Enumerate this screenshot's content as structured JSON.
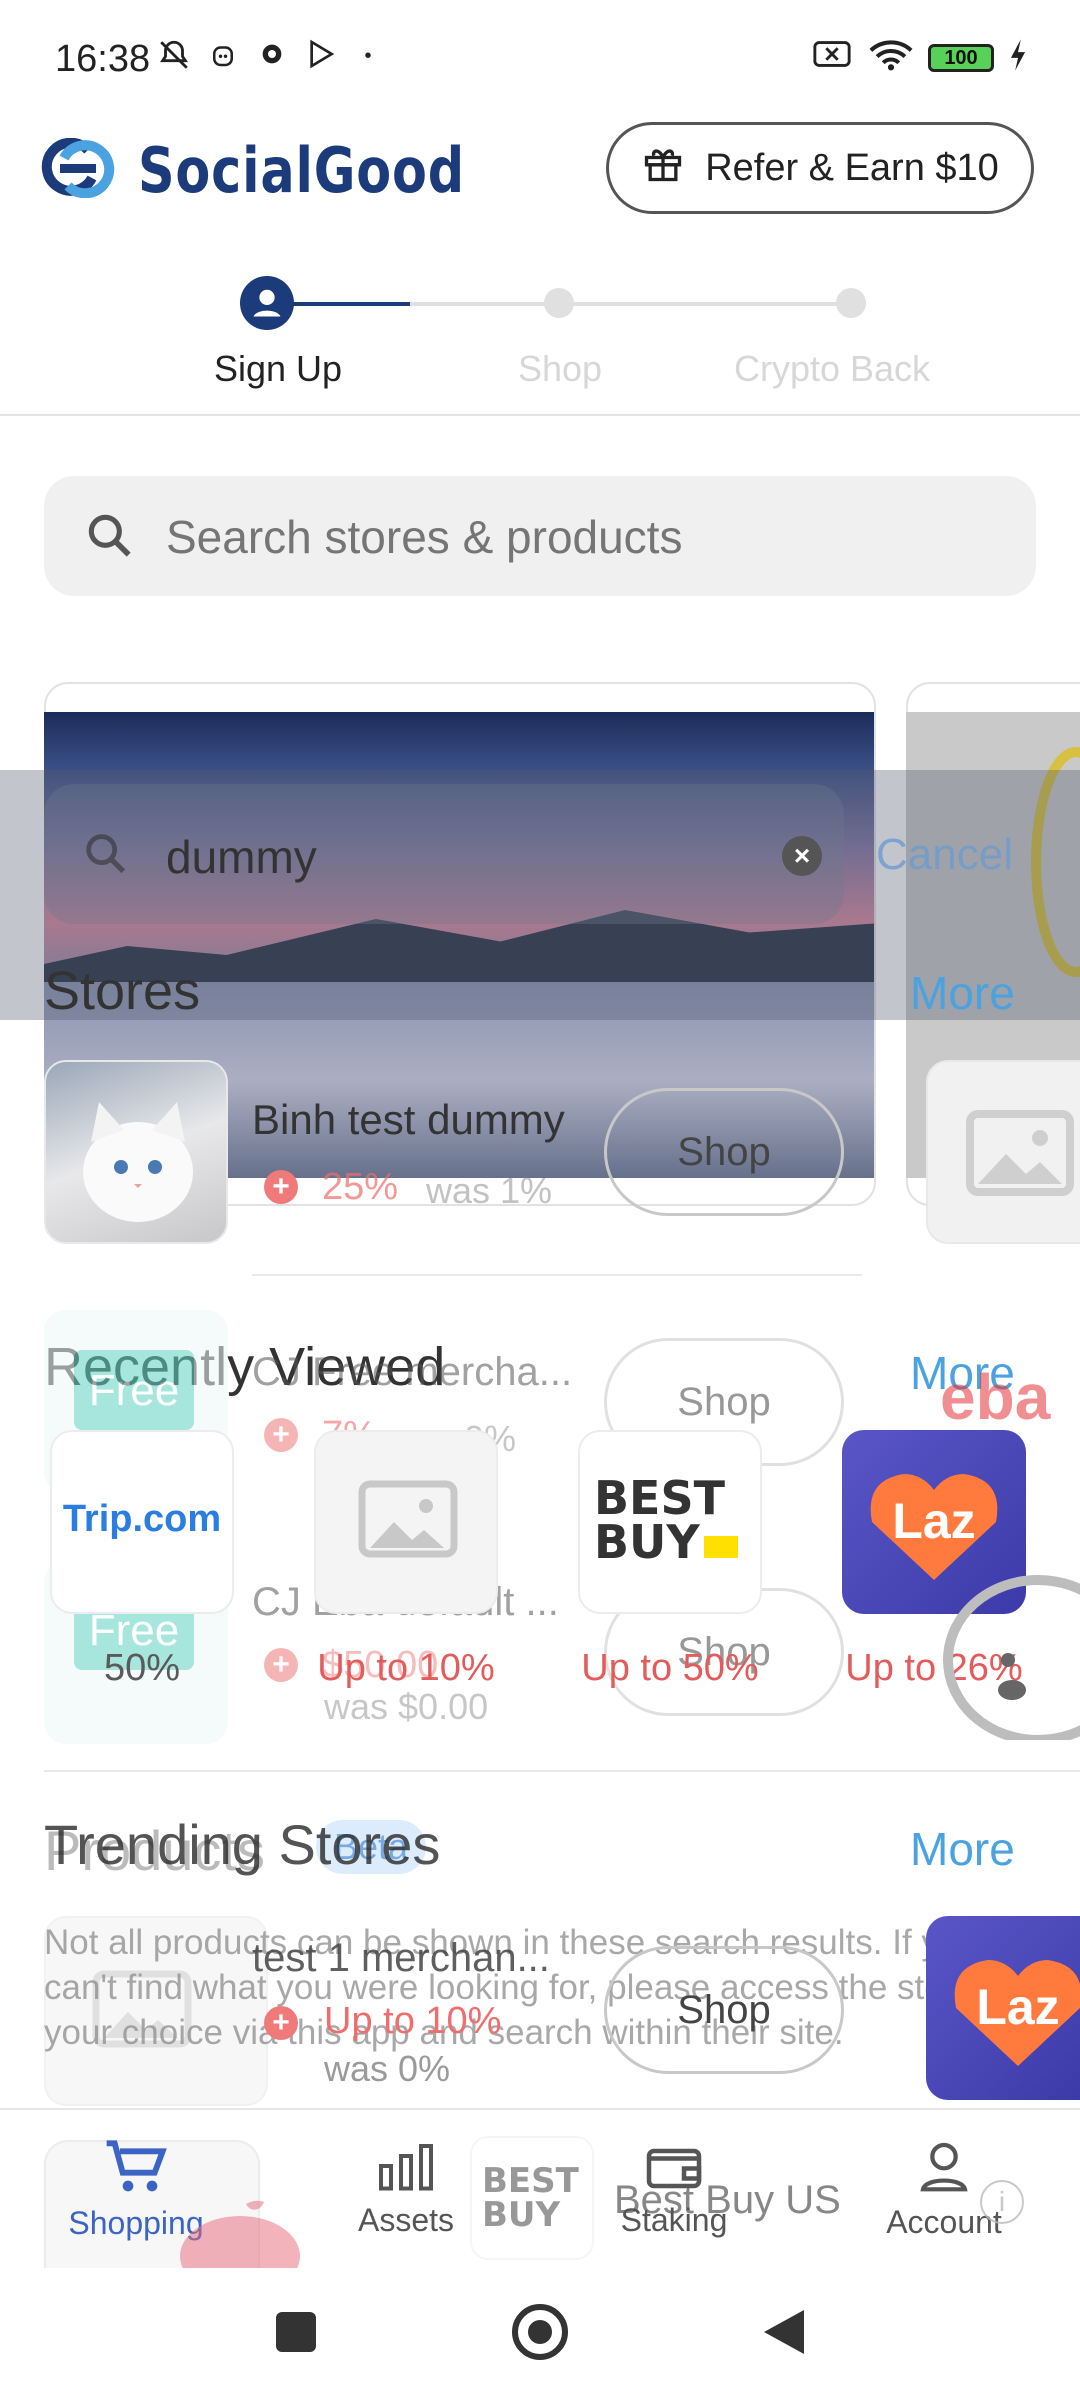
{
  "status_bar": {
    "time": "16:38",
    "battery": "100"
  },
  "header": {
    "brand": "SocialGood",
    "refer_label": "Refer & Earn $10"
  },
  "steps": [
    {
      "label": "Sign Up",
      "active": true
    },
    {
      "label": "Shop",
      "active": false
    },
    {
      "label": "Crypto Back",
      "active": false
    }
  ],
  "search": {
    "placeholder": "Search stores & products"
  },
  "overlay_search": {
    "query": "dummy",
    "cancel_label": "Cancel"
  },
  "stores_section": {
    "title": "Stores",
    "more_label": "More",
    "items": [
      {
        "name": "Binh test dummy",
        "cashback": "25%",
        "was": "was 1%",
        "action": "Shop"
      },
      {
        "name": "CJ Free merchant",
        "name_display": "CJ Free mercha...",
        "cashback": "7%",
        "was": "was 0%",
        "action": "Shop"
      },
      {
        "name": "CJ Eba default",
        "name_display": "CJ Eba default ...",
        "cashback": "$50.00",
        "was": "was $0.00",
        "action": "Shop"
      }
    ]
  },
  "recently_viewed": {
    "title": "Recently Viewed",
    "more_label": "More",
    "items": [
      {
        "name": "Trip.com",
        "cashback": "50%"
      },
      {
        "name": "Image placeholder",
        "cashback": "Up to 10%"
      },
      {
        "name": "Best Buy",
        "cashback": "Up to 50%"
      },
      {
        "name": "Laz",
        "cashback": "Up to 26%"
      }
    ]
  },
  "trending": {
    "title": "Trending Stores",
    "more_label": "More"
  },
  "products": {
    "title": "Products",
    "badge": "Beta",
    "more_label": "More",
    "note": "Not all products can be shown in these search results. If you can't find what you were looking for, please access the store of your choice via this app and search within their site.",
    "item": {
      "name": "test 1 merchan...",
      "cashback": "Up to 10%",
      "was": "was 0%",
      "action": "Shop"
    },
    "best_buy_label": "Best Buy US"
  },
  "bottom_nav": [
    {
      "label": "Shopping",
      "icon": "cart-icon",
      "active": true
    },
    {
      "label": "Assets",
      "icon": "bar-chart-icon",
      "active": false
    },
    {
      "label": "Staking",
      "icon": "wallet-icon",
      "active": false
    },
    {
      "label": "Account",
      "icon": "user-icon",
      "active": false
    }
  ],
  "colors": {
    "brand": "#1c3b7a",
    "accent": "#4aa3e0",
    "cashback": "#ef6d6d",
    "active_nav": "#3b64c4"
  }
}
